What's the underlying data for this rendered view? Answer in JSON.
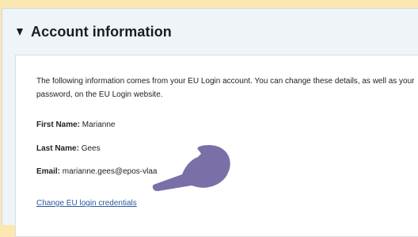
{
  "panel": {
    "title": "Account information"
  },
  "account": {
    "intro": "The following information comes from your EU Login account. You can change these details, as well as your password, on the EU Login website.",
    "first_name_label": "First Name:",
    "first_name_value": "Marianne",
    "last_name_label": "Last Name:",
    "last_name_value": "Gees",
    "email_label": "Email:",
    "email_value": "marianne.gees@epos-vlaa",
    "change_link": "Change EU login credentials"
  },
  "icons": {
    "toggle": "triangle-down-icon",
    "pointer": "pointing-hand-icon"
  },
  "colors": {
    "page_background": "#fbe8b0",
    "panel_background": "#eef4f8",
    "link": "#2a5b9e",
    "pointer_hand": "#7a6fa6"
  }
}
